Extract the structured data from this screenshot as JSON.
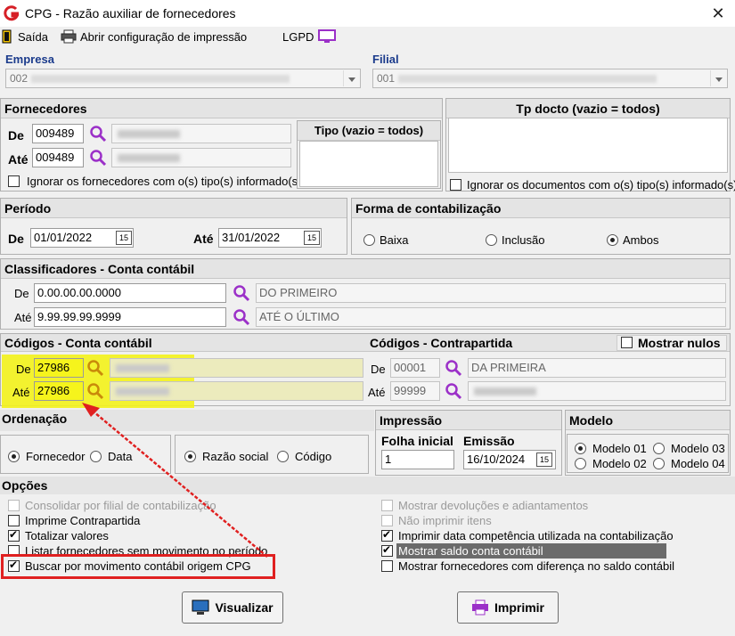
{
  "window": {
    "title": "CPG - Razão auxiliar de fornecedores",
    "close": "✕"
  },
  "toolbar": {
    "exit": "Saída",
    "print_config": "Abrir configuração de impressão",
    "lgpd": "LGPD"
  },
  "empresa": {
    "label": "Empresa",
    "value": "002"
  },
  "filial": {
    "label": "Filial",
    "value": "001"
  },
  "fornecedores": {
    "title": "Fornecedores",
    "de_label": "De",
    "de_value": "009489",
    "ate_label": "Até",
    "ate_value": "009489",
    "ignore_label": "Ignorar os fornecedores com o(s) tipo(s) informado(s)",
    "tipo_title": "Tipo (vazio = todos)"
  },
  "tp_docto": {
    "title": "Tp docto (vazio = todos)",
    "ignore_label": "Ignorar os documentos com o(s) tipo(s) informado(s)"
  },
  "periodo": {
    "title": "Período",
    "de_label": "De",
    "de_value": "01/01/2022",
    "ate_label": "Até",
    "ate_value": "31/01/2022"
  },
  "forma": {
    "title": "Forma de contabilização",
    "options": [
      "Baixa",
      "Inclusão",
      "Ambos"
    ],
    "selected": "Ambos"
  },
  "classificadores": {
    "title": "Classificadores - Conta contábil",
    "de_label": "De",
    "de_value": "0.00.00.00.0000",
    "de_desc": "DO PRIMEIRO",
    "ate_label": "Até",
    "ate_value": "9.99.99.99.9999",
    "ate_desc": "ATÉ O ÚLTIMO"
  },
  "codigos_conta": {
    "title": "Códigos - Conta contábil",
    "de_label": "De",
    "de_value": "27986",
    "ate_label": "Até",
    "ate_value": "27986"
  },
  "codigos_contrapartida": {
    "title": "Códigos - Contrapartida",
    "mostrar_nulos": "Mostrar nulos",
    "de_label": "De",
    "de_value": "00001",
    "de_desc": "DA PRIMEIRA",
    "ate_label": "Até",
    "ate_value": "99999"
  },
  "ordenacao": {
    "title": "Ordenação",
    "group1": [
      "Fornecedor",
      "Data"
    ],
    "group1_selected": "Fornecedor",
    "group2": [
      "Razão social",
      "Código"
    ],
    "group2_selected": "Razão social"
  },
  "impressao": {
    "title": "Impressão",
    "folha_label": "Folha inicial",
    "folha_value": "1",
    "emissao_label": "Emissão",
    "emissao_value": "16/10/2024"
  },
  "modelo": {
    "title": "Modelo",
    "options": [
      "Modelo 01",
      "Modelo 03",
      "Modelo 02",
      "Modelo 04"
    ],
    "selected": "Modelo 01"
  },
  "opcoes": {
    "title": "Opções",
    "left": [
      {
        "label": "Consolidar por filial de contabilização",
        "checked": false,
        "disabled": true
      },
      {
        "label": "Imprime Contrapartida",
        "checked": false,
        "disabled": false
      },
      {
        "label": "Totalizar valores",
        "checked": true,
        "disabled": false
      },
      {
        "label": "Listar fornecedores sem movimento no período",
        "checked": false,
        "disabled": false
      },
      {
        "label": "Buscar por movimento contábil origem CPG",
        "checked": true,
        "disabled": false
      }
    ],
    "right": [
      {
        "label": "Mostrar devoluções e adiantamentos",
        "checked": false,
        "disabled": true
      },
      {
        "label": "Não imprimir itens",
        "checked": false,
        "disabled": true
      },
      {
        "label": "Imprimir data competência utilizada na contabilização",
        "checked": true,
        "disabled": false
      },
      {
        "label": "Mostrar saldo conta contábil",
        "checked": true,
        "disabled": false
      },
      {
        "label": "Mostrar fornecedores com diferença no saldo contábil",
        "checked": false,
        "disabled": false
      }
    ]
  },
  "buttons": {
    "visualizar": "Visualizar",
    "imprimir": "Imprimir"
  },
  "colors": {
    "highlight": "#f3f21a",
    "red_box": "#e02020",
    "label_blue": "#1b3b8c",
    "mag": "#9b30c8"
  }
}
